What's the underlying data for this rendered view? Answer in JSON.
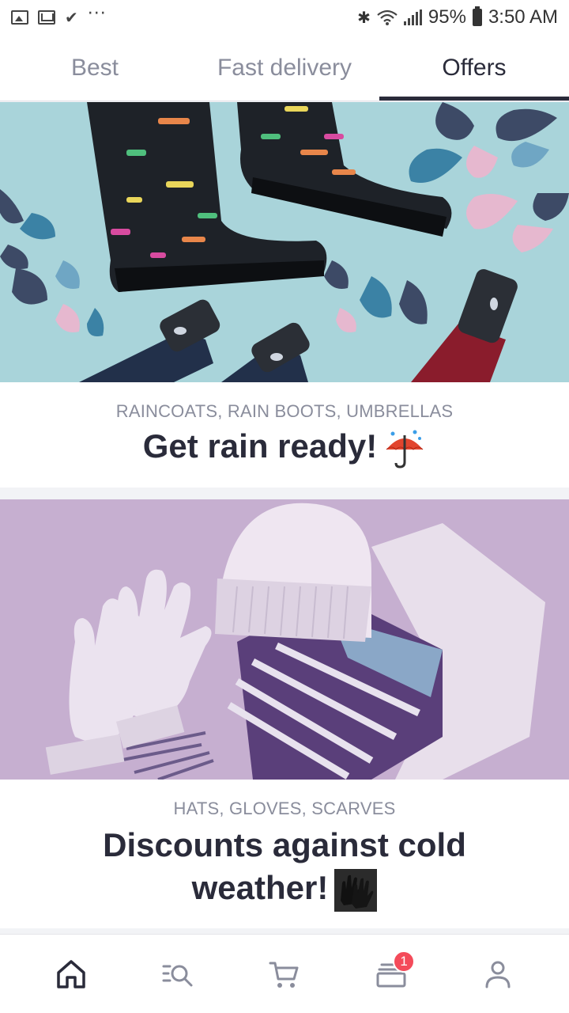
{
  "status_bar": {
    "battery": "95%",
    "time": "3:50 AM",
    "icons": [
      "gallery-icon",
      "gmail-icon",
      "check-icon",
      "more-icon",
      "bluetooth-icon",
      "wifi-icon",
      "signal-icon",
      "battery-icon"
    ]
  },
  "tabs": [
    {
      "label": "Best",
      "active": false
    },
    {
      "label": "Fast delivery",
      "active": false
    },
    {
      "label": "Offers",
      "active": true
    }
  ],
  "offers": [
    {
      "category": "RAINCOATS, RAIN BOOTS, UMBRELLAS",
      "title": "Get rain ready!",
      "emoji": "umbrella-icon",
      "image": "rain-boots-umbrellas-image"
    },
    {
      "category": "HATS, GLOVES, SCARVES",
      "title": "Discounts against cold weather!",
      "emoji": "gloves-icon",
      "image": "hat-gloves-scarf-image"
    }
  ],
  "bottom_nav": {
    "items": [
      "home-icon",
      "search-icon",
      "cart-icon",
      "orders-icon",
      "profile-icon"
    ],
    "orders_badge": "1"
  },
  "colors": {
    "text_dark": "#2a2b3a",
    "text_muted": "#8a8d9c",
    "badge": "#f44b5a",
    "rain_bg": "#a9d4da",
    "winter_bg": "#c6afd0"
  }
}
